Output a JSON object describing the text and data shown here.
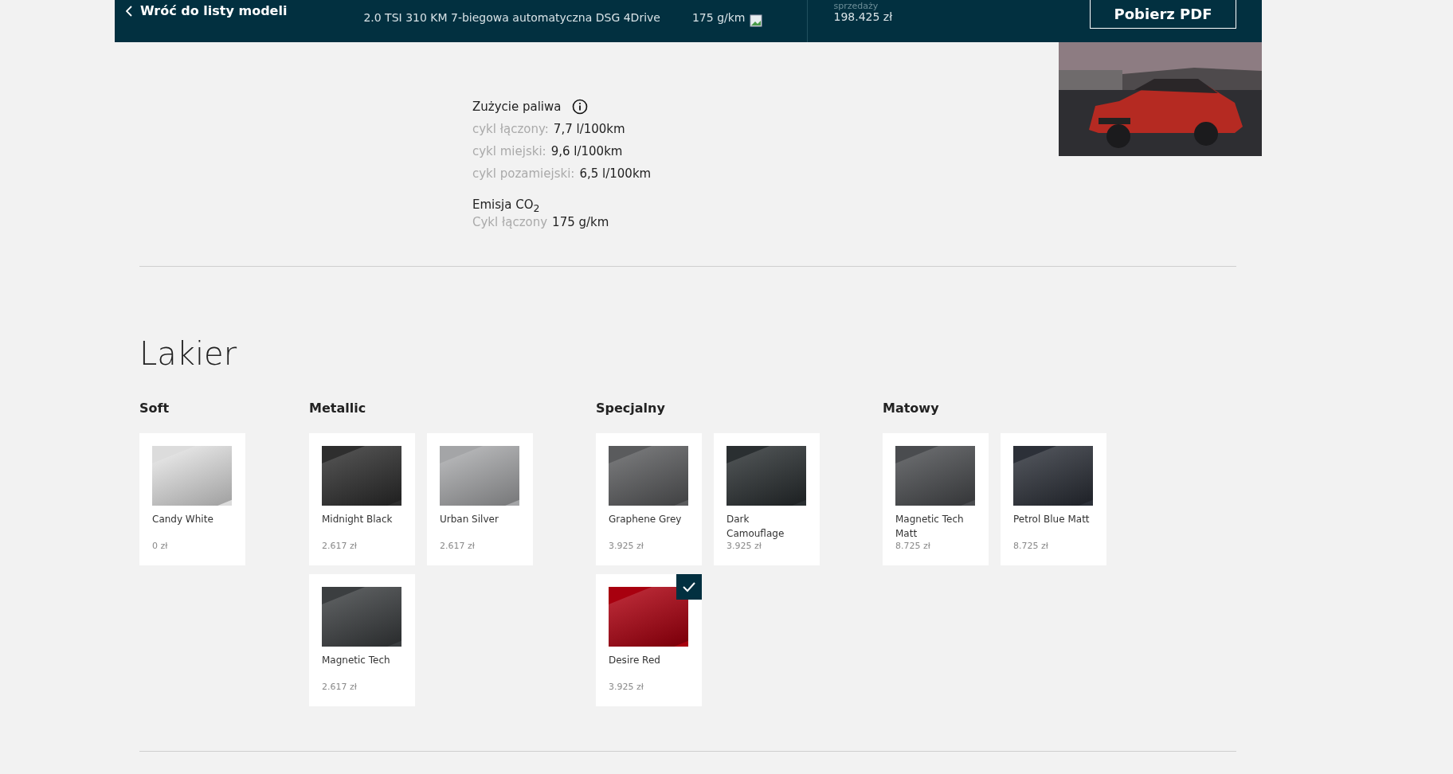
{
  "header": {
    "back_link": "Wróć do listy modeli",
    "model": "2.0 TSI 310 KM 7-biegowa automatyczna DSG 4Drive",
    "emission": "175 g/km",
    "price_label": "sprzedaży",
    "price": "198.425 zł",
    "pdf_button": "Pobierz PDF"
  },
  "fuel": {
    "title": "Zużycie paliwa",
    "rows": [
      {
        "label": "cykl łączony:",
        "value": "7,7 l/100km"
      },
      {
        "label": "cykl miejski:",
        "value": "9,6 l/100km"
      },
      {
        "label": "cykl pozamiejski:",
        "value": "6,5 l/100km"
      }
    ]
  },
  "emission": {
    "title": "Emisja CO$_{2}$",
    "label": "Cykl łączony",
    "value": "175 g/km"
  },
  "paint": {
    "title": "Lakier",
    "groups": [
      {
        "name": "Soft",
        "items": [
          {
            "name": "Candy White",
            "price": "0 zł",
            "color": "#dcdcdc",
            "selected": false
          }
        ]
      },
      {
        "name": "Metallic",
        "items": [
          {
            "name": "Midnight Black",
            "price": "2.617 zł",
            "color": "#2e2e2e",
            "selected": false
          },
          {
            "name": "Urban Silver",
            "price": "2.617 zł",
            "color": "#a4a5a7",
            "selected": false
          },
          {
            "name": "Magnetic Tech",
            "price": "2.617 zł",
            "color": "#3b3e40",
            "selected": false
          }
        ]
      },
      {
        "name": "Specjalny",
        "items": [
          {
            "name": "Graphene Grey",
            "price": "3.925 zł",
            "color": "#5a5b5d",
            "selected": false
          },
          {
            "name": "Dark Camouflage",
            "price": "3.925 zł",
            "color": "#2a2f31",
            "selected": false
          },
          {
            "name": "Desire Red",
            "price": "3.925 zł",
            "color": "#a8000f",
            "selected": true
          }
        ]
      },
      {
        "name": "Matowy",
        "items": [
          {
            "name": "Magnetic Tech Matt",
            "price": "8.725 zł",
            "color": "#4a4c4f",
            "selected": false
          },
          {
            "name": "Petrol Blue Matt",
            "price": "8.725 zł",
            "color": "#2c3038",
            "selected": false
          }
        ]
      }
    ]
  }
}
